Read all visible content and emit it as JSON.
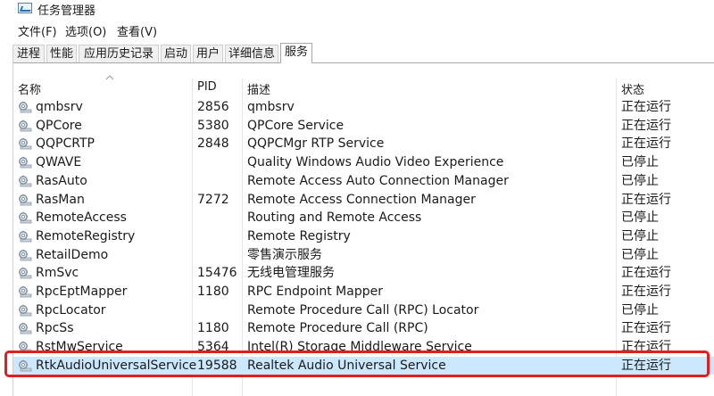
{
  "window": {
    "title": "任务管理器"
  },
  "menu": [
    "文件(F)",
    "选项(O)",
    "查看(V)"
  ],
  "tabs": [
    {
      "label": "进程"
    },
    {
      "label": "性能"
    },
    {
      "label": "应用历史记录"
    },
    {
      "label": "启动"
    },
    {
      "label": "用户"
    },
    {
      "label": "详细信息"
    },
    {
      "label": "服务",
      "active": true
    }
  ],
  "columns": {
    "name": "名称",
    "pid": "PID",
    "desc": "描述",
    "status": "状态"
  },
  "rows": [
    {
      "name": "qmbsrv",
      "pid": "2856",
      "desc": "qmbsrv",
      "status": "正在运行"
    },
    {
      "name": "QPCore",
      "pid": "5380",
      "desc": "QPCore Service",
      "status": "正在运行"
    },
    {
      "name": "QQPCRTP",
      "pid": "2848",
      "desc": "QQPCMgr RTP Service",
      "status": "正在运行"
    },
    {
      "name": "QWAVE",
      "pid": "",
      "desc": "Quality Windows Audio Video Experience",
      "status": "已停止"
    },
    {
      "name": "RasAuto",
      "pid": "",
      "desc": "Remote Access Auto Connection Manager",
      "status": "已停止"
    },
    {
      "name": "RasMan",
      "pid": "7272",
      "desc": "Remote Access Connection Manager",
      "status": "正在运行"
    },
    {
      "name": "RemoteAccess",
      "pid": "",
      "desc": "Routing and Remote Access",
      "status": "已停止"
    },
    {
      "name": "RemoteRegistry",
      "pid": "",
      "desc": "Remote Registry",
      "status": "已停止"
    },
    {
      "name": "RetailDemo",
      "pid": "",
      "desc": "零售演示服务",
      "status": "已停止"
    },
    {
      "name": "RmSvc",
      "pid": "15476",
      "desc": "无线电管理服务",
      "status": "正在运行"
    },
    {
      "name": "RpcEptMapper",
      "pid": "1180",
      "desc": "RPC Endpoint Mapper",
      "status": "正在运行"
    },
    {
      "name": "RpcLocator",
      "pid": "",
      "desc": "Remote Procedure Call (RPC) Locator",
      "status": "已停止"
    },
    {
      "name": "RpcSs",
      "pid": "1180",
      "desc": "Remote Procedure Call (RPC)",
      "status": "正在运行"
    },
    {
      "name": "RstMwService",
      "pid": "5364",
      "desc": "Intel(R) Storage Middleware Service",
      "status": "正在运行"
    },
    {
      "name": "RtkAudioUniversalService",
      "pid": "19588",
      "desc": "Realtek Audio Universal Service",
      "status": "正在运行",
      "selected": true
    }
  ],
  "colors": {
    "selected_row": "#cce8ff",
    "highlight_border": "#e02020"
  }
}
